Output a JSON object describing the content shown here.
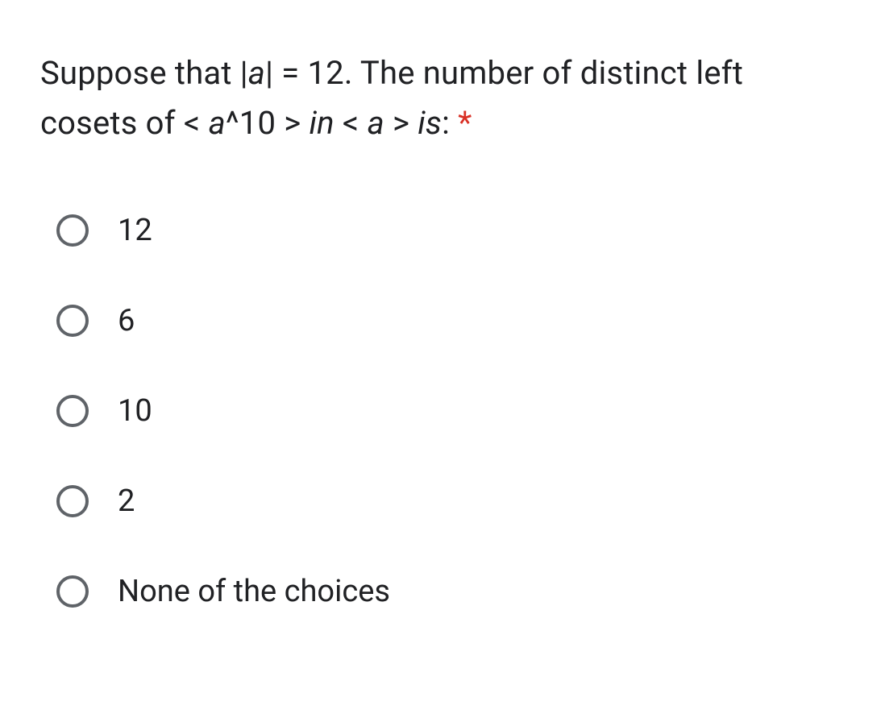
{
  "question": {
    "part1": "Suppose that |",
    "ital1": "a",
    "part2": "| = 12. The number of distinct left cosets of < ",
    "ital2": "a",
    "part3": "^10 > ",
    "ital3": "in",
    "part4": " < ",
    "ital4": "a",
    "part5": " > ",
    "ital5": "is",
    "part6": ":",
    "asterisk": "*"
  },
  "options": [
    {
      "label": "12"
    },
    {
      "label": "6"
    },
    {
      "label": "10"
    },
    {
      "label": "2"
    },
    {
      "label": "None of the choices"
    }
  ]
}
